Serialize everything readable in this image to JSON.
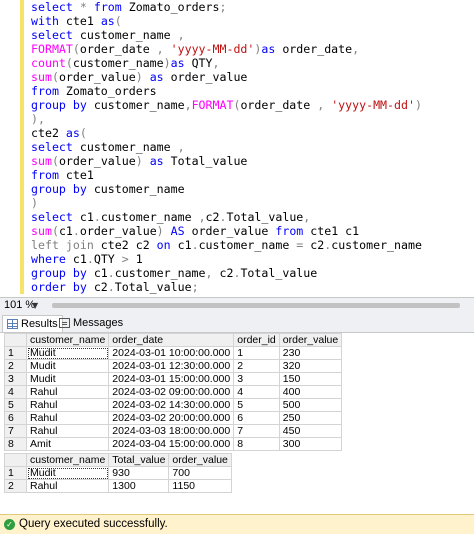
{
  "editor": {
    "lines": [
      [
        [
          "k",
          "select"
        ],
        [
          "n",
          " "
        ],
        [
          "g",
          "*"
        ],
        [
          "n",
          " "
        ],
        [
          "k",
          "from"
        ],
        [
          "n",
          " Zomato_orders"
        ],
        [
          "g",
          ";"
        ]
      ],
      [
        [
          "k",
          "with"
        ],
        [
          "n",
          " cte1 "
        ],
        [
          "k",
          "as"
        ],
        [
          "g",
          "("
        ]
      ],
      [
        [
          "k",
          "select"
        ],
        [
          "n",
          " customer_name "
        ],
        [
          "g",
          ","
        ]
      ],
      [
        [
          "f",
          "FORMAT"
        ],
        [
          "g",
          "("
        ],
        [
          "n",
          "order_date "
        ],
        [
          "g",
          ","
        ],
        [
          "n",
          " "
        ],
        [
          "s",
          "'yyyy-MM-dd'"
        ],
        [
          "g",
          ")"
        ],
        [
          "k",
          "as"
        ],
        [
          "n",
          " order_date"
        ],
        [
          "g",
          ","
        ]
      ],
      [
        [
          "f",
          "count"
        ],
        [
          "g",
          "("
        ],
        [
          "n",
          "customer_name"
        ],
        [
          "g",
          ")"
        ],
        [
          "k",
          "as"
        ],
        [
          "n",
          " QTY"
        ],
        [
          "g",
          ","
        ]
      ],
      [
        [
          "f",
          "sum"
        ],
        [
          "g",
          "("
        ],
        [
          "n",
          "order_value"
        ],
        [
          "g",
          ")"
        ],
        [
          "n",
          " "
        ],
        [
          "k",
          "as"
        ],
        [
          "n",
          " order_value"
        ]
      ],
      [
        [
          "k",
          "from"
        ],
        [
          "n",
          " Zomato_orders"
        ]
      ],
      [
        [
          "k",
          "group by"
        ],
        [
          "n",
          " customer_name"
        ],
        [
          "g",
          ","
        ],
        [
          "f",
          "FORMAT"
        ],
        [
          "g",
          "("
        ],
        [
          "n",
          "order_date "
        ],
        [
          "g",
          ","
        ],
        [
          "n",
          " "
        ],
        [
          "s",
          "'yyyy-MM-dd'"
        ],
        [
          "g",
          ")"
        ]
      ],
      [
        [
          "g",
          "),"
        ]
      ],
      [
        [
          "n",
          "cte2 "
        ],
        [
          "k",
          "as"
        ],
        [
          "g",
          "("
        ]
      ],
      [
        [
          "k",
          "select"
        ],
        [
          "n",
          " customer_name "
        ],
        [
          "g",
          ","
        ]
      ],
      [
        [
          "f",
          "sum"
        ],
        [
          "g",
          "("
        ],
        [
          "n",
          "order_value"
        ],
        [
          "g",
          ")"
        ],
        [
          "n",
          " "
        ],
        [
          "k",
          "as"
        ],
        [
          "n",
          " Total_value"
        ]
      ],
      [
        [
          "k",
          "from"
        ],
        [
          "n",
          " cte1"
        ]
      ],
      [
        [
          "k",
          "group by"
        ],
        [
          "n",
          " customer_name"
        ]
      ],
      [
        [
          "g",
          ")"
        ]
      ],
      [
        [
          "k",
          "select"
        ],
        [
          "n",
          " c1"
        ],
        [
          "g",
          "."
        ],
        [
          "n",
          "customer_name "
        ],
        [
          "g",
          ","
        ],
        [
          "n",
          "c2"
        ],
        [
          "g",
          "."
        ],
        [
          "n",
          "Total_value"
        ],
        [
          "g",
          ","
        ]
      ],
      [
        [
          "f",
          "sum"
        ],
        [
          "g",
          "("
        ],
        [
          "n",
          "c1"
        ],
        [
          "g",
          "."
        ],
        [
          "n",
          "order_value"
        ],
        [
          "g",
          ")"
        ],
        [
          "n",
          " "
        ],
        [
          "k",
          "AS"
        ],
        [
          "n",
          " order_value "
        ],
        [
          "k",
          "from"
        ],
        [
          "n",
          " cte1 c1"
        ]
      ],
      [
        [
          "g",
          "left join"
        ],
        [
          "n",
          " cte2 c2 "
        ],
        [
          "k",
          "on"
        ],
        [
          "n",
          " c1"
        ],
        [
          "g",
          "."
        ],
        [
          "n",
          "customer_name "
        ],
        [
          "g",
          "="
        ],
        [
          "n",
          " c2"
        ],
        [
          "g",
          "."
        ],
        [
          "n",
          "customer_name"
        ]
      ],
      [
        [
          "k",
          "where"
        ],
        [
          "n",
          " c1"
        ],
        [
          "g",
          "."
        ],
        [
          "n",
          "QTY "
        ],
        [
          "g",
          ">"
        ],
        [
          "n",
          " 1"
        ]
      ],
      [
        [
          "k",
          "group by"
        ],
        [
          "n",
          " c1"
        ],
        [
          "g",
          "."
        ],
        [
          "n",
          "customer_name"
        ],
        [
          "g",
          ","
        ],
        [
          "n",
          " c2"
        ],
        [
          "g",
          "."
        ],
        [
          "n",
          "Total_value"
        ]
      ],
      [
        [
          "k",
          "order by"
        ],
        [
          "n",
          " c2"
        ],
        [
          "g",
          "."
        ],
        [
          "n",
          "Total_value"
        ],
        [
          "g",
          ";"
        ]
      ]
    ]
  },
  "zoom": {
    "label": "101 %"
  },
  "tabs": {
    "results_label": "Results",
    "messages_label": "Messages"
  },
  "grid1": {
    "columns": [
      "customer_name",
      "order_date",
      "order_id",
      "order_value"
    ],
    "rows": [
      [
        "1",
        "Mudit",
        "2024-03-01 10:00:00.000",
        "1",
        "230"
      ],
      [
        "2",
        "Mudit",
        "2024-03-01 12:30:00.000",
        "2",
        "320"
      ],
      [
        "3",
        "Mudit",
        "2024-03-01 15:00:00.000",
        "3",
        "150"
      ],
      [
        "4",
        "Rahul",
        "2024-03-02 09:00:00.000",
        "4",
        "400"
      ],
      [
        "5",
        "Rahul",
        "2024-03-02 14:30:00.000",
        "5",
        "500"
      ],
      [
        "6",
        "Rahul",
        "2024-03-02 20:00:00.000",
        "6",
        "250"
      ],
      [
        "7",
        "Rahul",
        "2024-03-03 18:00:00.000",
        "7",
        "450"
      ],
      [
        "8",
        "Amit",
        "2024-03-04 15:00:00.000",
        "8",
        "300"
      ]
    ]
  },
  "grid2": {
    "columns": [
      "customer_name",
      "Total_value",
      "order_value"
    ],
    "rows": [
      [
        "1",
        "Mudit",
        "930",
        "700"
      ],
      [
        "2",
        "Rahul",
        "1300",
        "1150"
      ]
    ]
  },
  "status": {
    "message": "Query executed successfully.",
    "color": "#fff2cc"
  }
}
